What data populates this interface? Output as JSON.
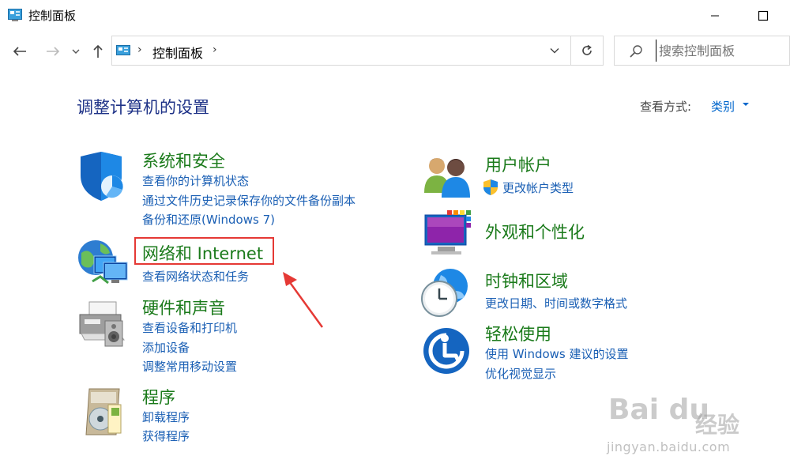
{
  "window": {
    "title": "控制面板"
  },
  "address": {
    "crumb": "控制面板",
    "sep1": "›",
    "sep2": "›"
  },
  "search": {
    "placeholder": "搜索控制面板"
  },
  "page": {
    "title": "调整计算机的设置",
    "viewby_label": "查看方式:",
    "viewby_value": "类别"
  },
  "categories": {
    "system": {
      "title": "系统和安全",
      "links": [
        "查看你的计算机状态",
        "通过文件历史记录保存你的文件备份副本",
        "备份和还原(Windows 7)"
      ]
    },
    "network": {
      "title": "网络和 Internet",
      "links": [
        "查看网络状态和任务"
      ]
    },
    "hardware": {
      "title": "硬件和声音",
      "links": [
        "查看设备和打印机",
        "添加设备",
        "调整常用移动设置"
      ]
    },
    "programs": {
      "title": "程序",
      "links": [
        "卸载程序",
        "获得程序"
      ]
    },
    "user": {
      "title": "用户帐户",
      "links": [
        "更改帐户类型"
      ]
    },
    "appearance": {
      "title": "外观和个性化",
      "links": []
    },
    "clock": {
      "title": "时钟和区域",
      "links": [
        "更改日期、时间或数字格式"
      ]
    },
    "ease": {
      "title": "轻松使用",
      "links": [
        "使用 Windows 建议的设置",
        "优化视觉显示"
      ]
    }
  },
  "watermark": {
    "logo": "Bai du",
    "cn": "经验",
    "url": "jingyan.baidu.com"
  },
  "colors": {
    "title_blue": "#1e3287",
    "category_green": "#1a7a1a",
    "link_blue": "#1a5fb4",
    "highlight_red": "#e53935"
  }
}
